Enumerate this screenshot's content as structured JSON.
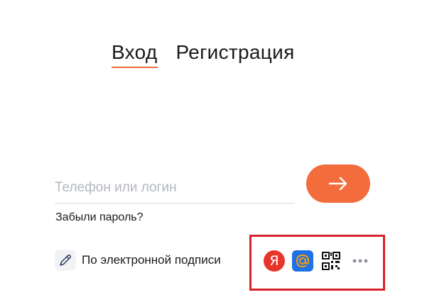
{
  "tabs": [
    {
      "label": "Вход",
      "active": true
    },
    {
      "label": "Регистрация",
      "active": false
    }
  ],
  "login": {
    "placeholder": "Телефон или логин",
    "value": ""
  },
  "submit_icon": "arrow-right-icon",
  "forgot_password": "Забыли пароль?",
  "digital_signature": {
    "label": "По электронной подписи",
    "icon": "pen-icon"
  },
  "providers": [
    {
      "name": "yandex",
      "glyph": "Я",
      "color": "#e8352c",
      "icon": "yandex-icon"
    },
    {
      "name": "mail.ru",
      "glyph": "@",
      "color": "#1e72e6",
      "icon": "mailru-icon"
    },
    {
      "name": "qr-code",
      "icon": "qr-code-icon"
    },
    {
      "name": "more",
      "icon": "more-icon"
    }
  ],
  "colors": {
    "accent": "#f36c3b",
    "highlight": "#d8232a"
  }
}
